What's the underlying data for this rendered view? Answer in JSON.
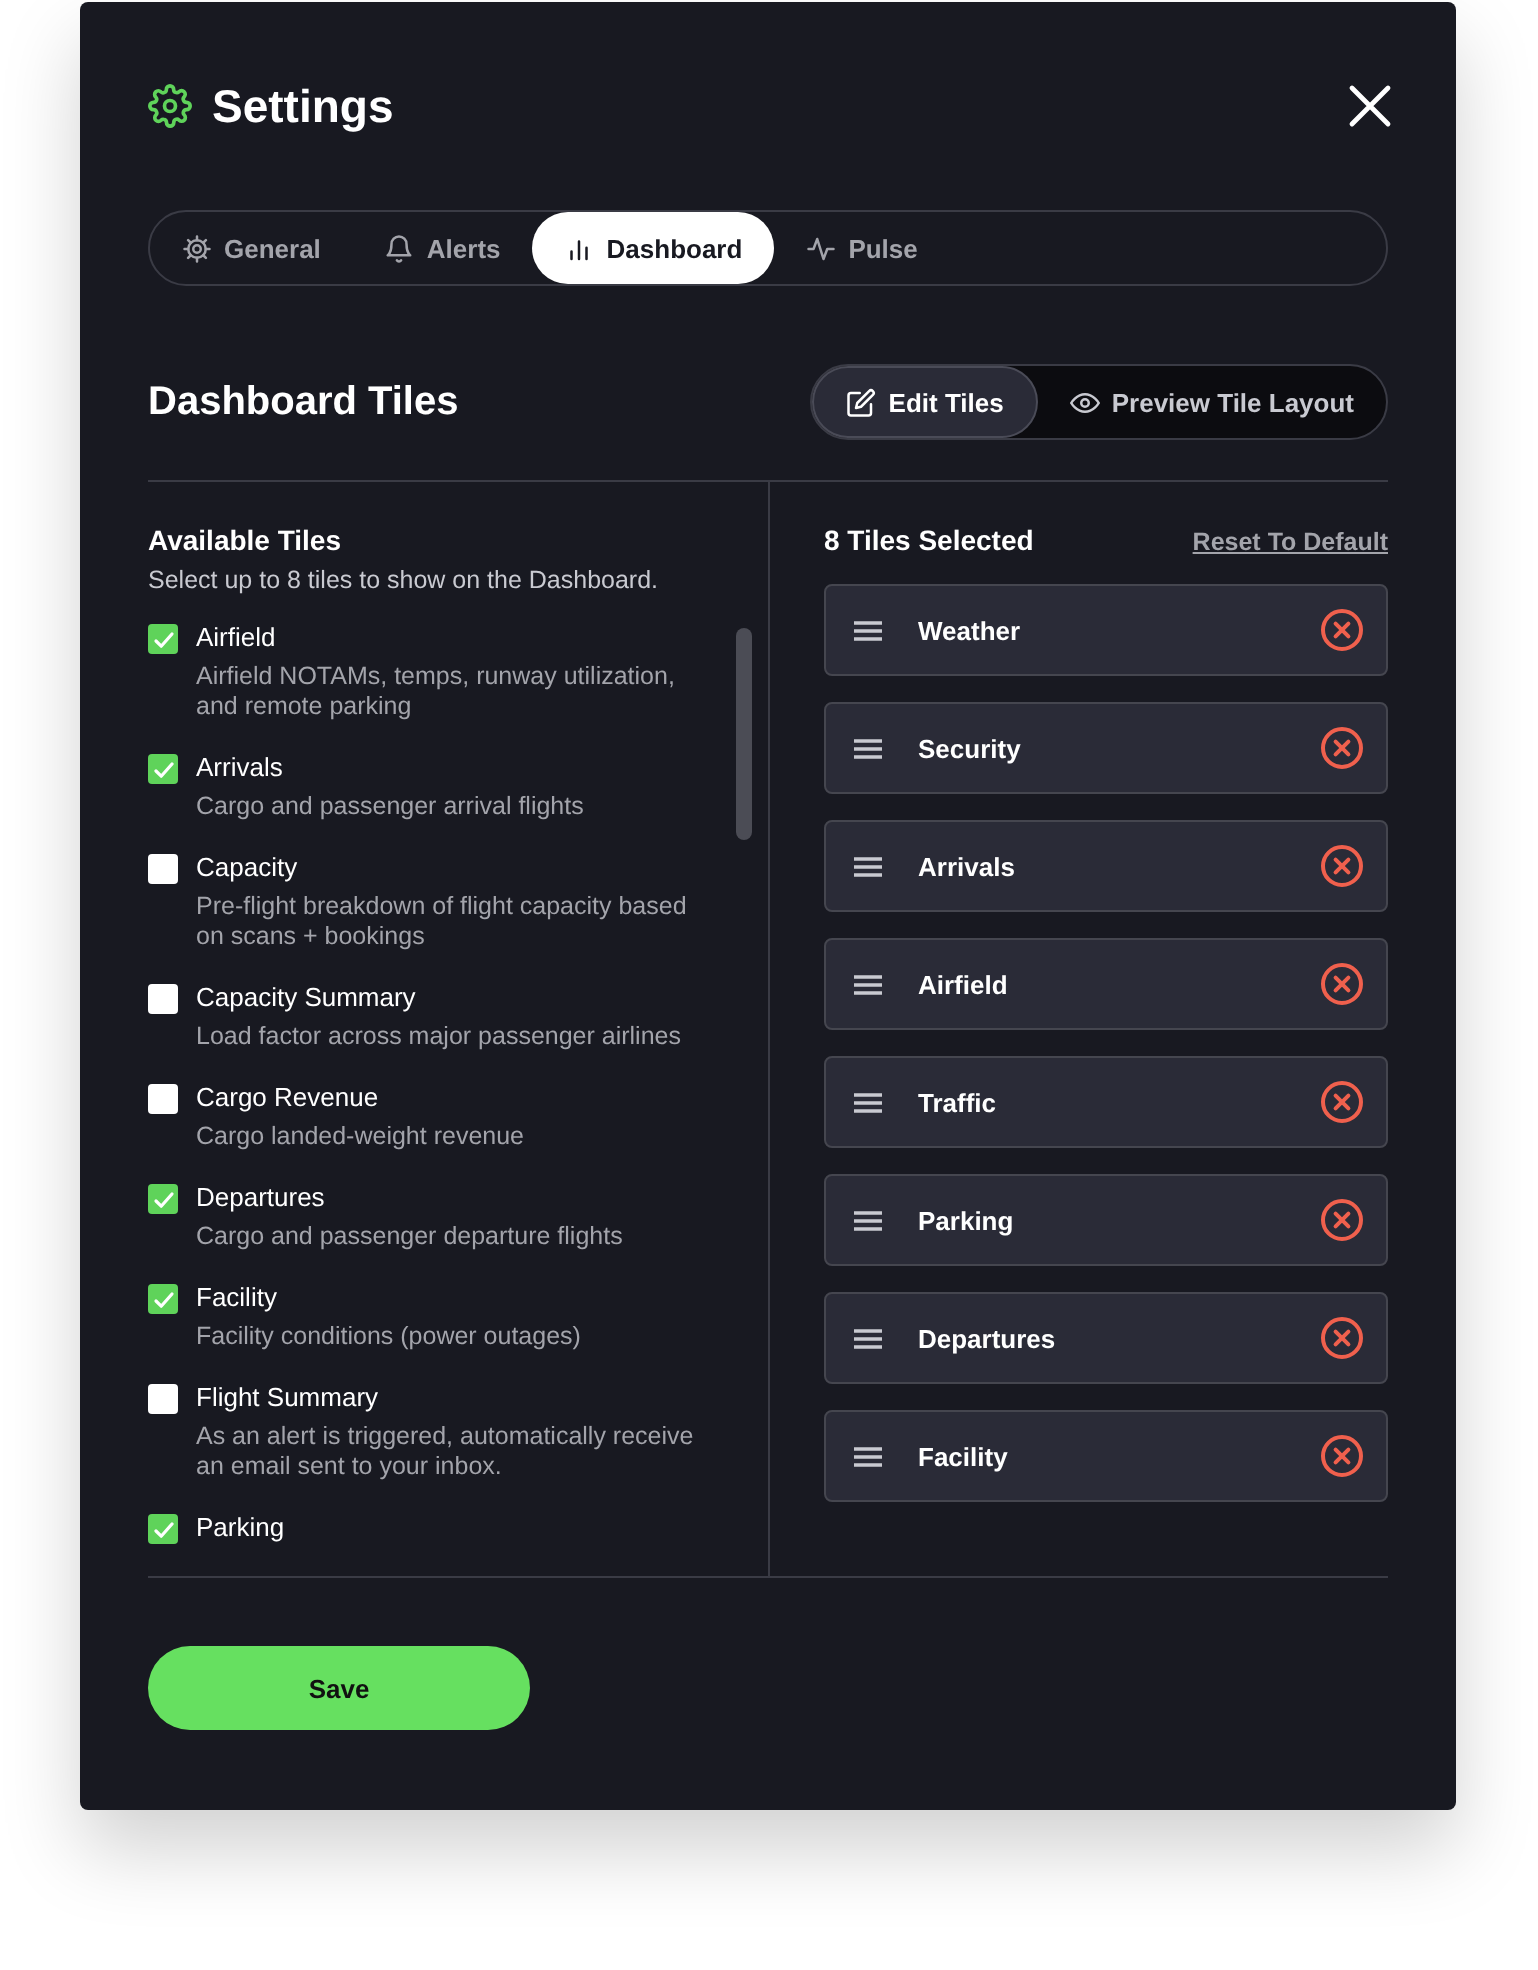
{
  "dialog": {
    "title": "Settings"
  },
  "tabs": [
    {
      "label": "General",
      "selected": false
    },
    {
      "label": "Alerts",
      "selected": false
    },
    {
      "label": "Dashboard",
      "selected": true
    },
    {
      "label": "Pulse",
      "selected": false
    }
  ],
  "section": {
    "title": "Dashboard Tiles"
  },
  "view_toggle": [
    {
      "label": "Edit Tiles",
      "selected": true
    },
    {
      "label": "Preview Tile Layout",
      "selected": false
    }
  ],
  "available": {
    "title": "Available Tiles",
    "hint": "Select up to 8 tiles to show on the Dashboard.",
    "items": [
      {
        "name": "Airfield",
        "description": "Airfield NOTAMs, temps, runway utilization, and remote parking",
        "checked": true
      },
      {
        "name": "Arrivals",
        "description": "Cargo and passenger arrival flights",
        "checked": true
      },
      {
        "name": "Capacity",
        "description": "Pre-flight breakdown of flight capacity based on scans + bookings",
        "checked": false
      },
      {
        "name": "Capacity Summary",
        "description": "Load factor across major passenger airlines",
        "checked": false
      },
      {
        "name": "Cargo Revenue",
        "description": "Cargo landed-weight revenue",
        "checked": false
      },
      {
        "name": "Departures",
        "description": "Cargo and passenger departure flights",
        "checked": true
      },
      {
        "name": "Facility",
        "description": "Facility conditions (power outages)",
        "checked": true
      },
      {
        "name": "Flight Summary",
        "description": "As an alert is triggered, automatically receive an email sent to your inbox.",
        "checked": false
      },
      {
        "name": "Parking",
        "checked": true
      }
    ]
  },
  "selected": {
    "title": "8 Tiles Selected",
    "reset_link": "Reset To Default",
    "tiles": [
      "Weather",
      "Security",
      "Arrivals",
      "Airfield",
      "Traffic",
      "Parking",
      "Departures",
      "Facility"
    ]
  },
  "save_button": "Save"
}
